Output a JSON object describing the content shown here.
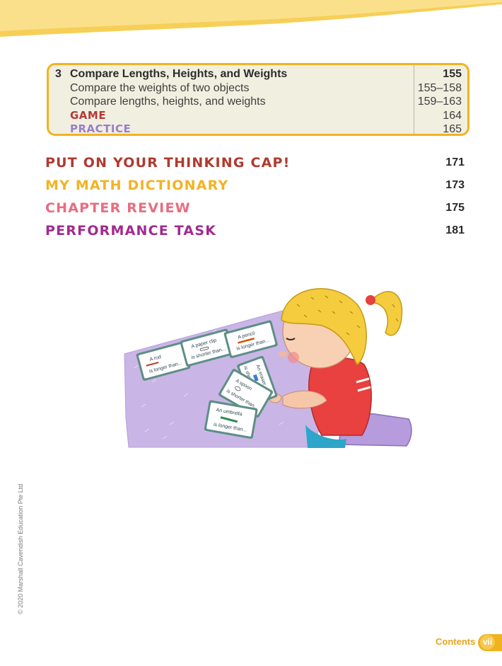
{
  "lesson": {
    "number": "3",
    "title": "Compare Lengths, Heights, and Weights",
    "page": "155",
    "items": [
      {
        "label": "Compare the weights of two objects",
        "page": "155–158"
      },
      {
        "label": "Compare lengths, heights, and weights",
        "page": "159–163"
      },
      {
        "label": "GAME",
        "page": "164"
      },
      {
        "label": "PRACTICE",
        "page": "165"
      }
    ]
  },
  "sections": [
    {
      "label": "PUT ON YOUR THINKING CAP!",
      "page": "171",
      "color": "#b03a2e"
    },
    {
      "label": "MY MATH DICTIONARY",
      "page": "173",
      "color": "#f1b325"
    },
    {
      "label": "CHAPTER REVIEW",
      "page": "175",
      "color": "#e86d7f"
    },
    {
      "label": "PERFORMANCE TASK",
      "page": "181",
      "color": "#a02b8f"
    }
  ],
  "cards": [
    {
      "line1": "A rod",
      "line2": "is longer than..."
    },
    {
      "line1": "A paper clip",
      "line2": "is shorter than..."
    },
    {
      "line1": "A pencil",
      "line2": "is longer than..."
    },
    {
      "line1": "An eraser",
      "line2": "is shorter than..."
    },
    {
      "line1": "A spoon",
      "line2": "is shorter than..."
    },
    {
      "line1": "An umbrella",
      "line2": "is longer than..."
    }
  ],
  "copyright": "© 2020 Marshall Cavendish Education Pte Ltd",
  "footer": {
    "label": "Contents",
    "page": "vii"
  },
  "colors": {
    "accent": "#f2b320",
    "box_bg": "#f1efe0",
    "table": "#c9b6e6"
  }
}
